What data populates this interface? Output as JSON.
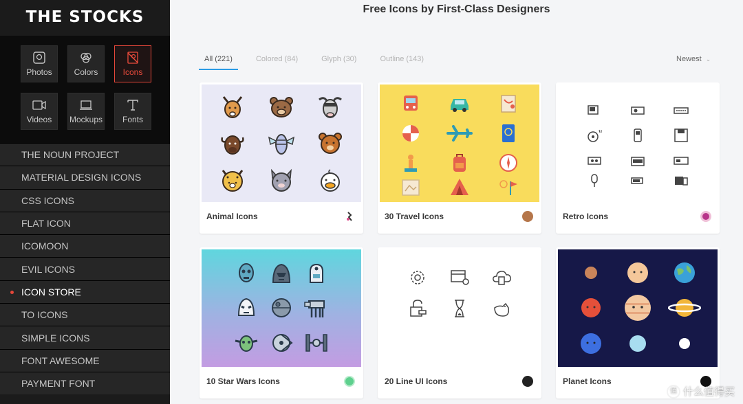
{
  "brand": "THE STOCKS",
  "categories": [
    {
      "label": "Photos",
      "icon": "photo-icon"
    },
    {
      "label": "Colors",
      "icon": "colors-icon"
    },
    {
      "label": "Icons",
      "icon": "icons-icon",
      "active": true
    },
    {
      "label": "Videos",
      "icon": "video-camera-icon"
    },
    {
      "label": "Mockups",
      "icon": "laptop-icon"
    },
    {
      "label": "Fonts",
      "icon": "font-icon"
    }
  ],
  "nav": [
    {
      "label": "THE NOUN PROJECT"
    },
    {
      "label": "MATERIAL DESIGN ICONS"
    },
    {
      "label": "CSS ICONS"
    },
    {
      "label": "FLAT ICON"
    },
    {
      "label": "ICOMOON"
    },
    {
      "label": "EVIL ICONS"
    },
    {
      "label": "ICON STORE",
      "active": true
    },
    {
      "label": "TO ICONS"
    },
    {
      "label": "SIMPLE ICONS"
    },
    {
      "label": "FONT AWESOME"
    },
    {
      "label": "PAYMENT FONT"
    }
  ],
  "page_title": "Free Icons by First-Class Designers",
  "tabs": [
    {
      "label": "All (221)",
      "active": true
    },
    {
      "label": "Colored (84)"
    },
    {
      "label": "Glyph (30)"
    },
    {
      "label": "Outline (143)"
    }
  ],
  "sort": {
    "selected": "Newest"
  },
  "cards": [
    {
      "title": "Animal Icons",
      "bg": "#e9e9f6"
    },
    {
      "title": "30 Travel Icons",
      "bg": "#f9dc5c"
    },
    {
      "title": "Retro Icons",
      "bg": "#ffffff"
    },
    {
      "title": "10 Star Wars Icons",
      "bg": "#6fd2dc"
    },
    {
      "title": "20 Line UI Icons",
      "bg": "#ffffff"
    },
    {
      "title": "Planet Icons",
      "bg": "#161848"
    }
  ],
  "watermark": "什么值得买",
  "colors": {
    "accent": "#e5473a",
    "tab_active": "#2b9be5"
  }
}
